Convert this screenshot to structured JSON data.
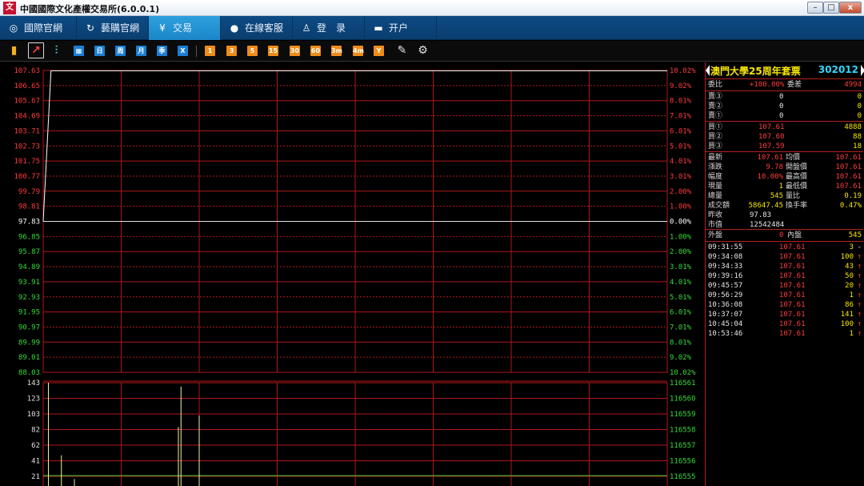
{
  "window": {
    "title": "中國國際文化產權交易所(6.0.0.1)",
    "icon_text": "文"
  },
  "nav": {
    "tabs": [
      {
        "label": "國際官網",
        "icon": "globe-icon"
      },
      {
        "label": "藝購官網",
        "icon": "link-icon"
      },
      {
        "label": "交易",
        "icon": "trade-icon"
      },
      {
        "label": "在線客服",
        "icon": "chat-icon"
      },
      {
        "label": "登　录",
        "icon": "user-icon"
      },
      {
        "label": "开户",
        "icon": "card-icon"
      }
    ]
  },
  "toolbar": {
    "period_buttons": [
      "日",
      "周",
      "月",
      "季",
      "X"
    ],
    "minute_buttons": [
      "1",
      "3",
      "5",
      "15",
      "30",
      "60",
      "3m",
      "4m",
      "Y"
    ]
  },
  "chart_data": {
    "type": "line",
    "price_axis_left": [
      "107.63",
      "106.65",
      "105.67",
      "104.69",
      "103.71",
      "102.73",
      "101.75",
      "100.77",
      "99.79",
      "98.81",
      "97.83",
      "96.85",
      "95.87",
      "94.89",
      "93.91",
      "92.93",
      "91.95",
      "90.97",
      "89.99",
      "89.01",
      "88.03"
    ],
    "price_axis_right": [
      "10.02%",
      "9.02%",
      "8.01%",
      "7.01%",
      "6.01%",
      "5.01%",
      "4.01%",
      "3.01%",
      "2.00%",
      "1.00%",
      "0.00%",
      "1.00%",
      "2.00%",
      "3.01%",
      "4.01%",
      "5.01%",
      "6.01%",
      "7.01%",
      "8.01%",
      "9.02%",
      "10.02%"
    ],
    "volume_axis_left": [
      "143",
      "123",
      "103",
      "82",
      "62",
      "41",
      "21"
    ],
    "volume_axis_right": [
      "116561",
      "116560",
      "116559",
      "116558",
      "116557",
      "116556",
      "116555"
    ],
    "prev_close": 97.83,
    "price_ylim": [
      88.03,
      107.63
    ],
    "price_series": {
      "x_minutes": [
        0,
        3,
        240
      ],
      "values": [
        97.83,
        107.61,
        107.61
      ]
    },
    "volume_ylim": [
      0,
      143
    ],
    "volume_bars": [
      {
        "minute": 2,
        "value": 143
      },
      {
        "minute": 7,
        "value": 48
      },
      {
        "minute": 12,
        "value": 17
      },
      {
        "minute": 52,
        "value": 85
      },
      {
        "minute": 53,
        "value": 138
      },
      {
        "minute": 60,
        "value": 100
      }
    ],
    "grid": true,
    "colors": {
      "grid": "#b01818",
      "price_line": "#ffffff",
      "volume_bar": "#f0f0a0",
      "baseline": "#33cc33",
      "up": "#ff3b3b",
      "down": "#33dd33",
      "flat": "#ffffff"
    }
  },
  "quote": {
    "name": "澳門大學25周年套票",
    "code": "302012",
    "webi": {
      "label": "委比",
      "value": "+100.00%",
      "label2": "委差",
      "value2": "4994"
    },
    "asks": [
      {
        "label": "賣③",
        "price": "0",
        "vol": "0"
      },
      {
        "label": "賣②",
        "price": "0",
        "vol": "0"
      },
      {
        "label": "賣①",
        "price": "0",
        "vol": "0"
      }
    ],
    "bids": [
      {
        "label": "買①",
        "price": "107.61",
        "vol": "4888"
      },
      {
        "label": "買②",
        "price": "107.60",
        "vol": "88"
      },
      {
        "label": "買③",
        "price": "107.59",
        "vol": "18"
      }
    ],
    "stats": [
      {
        "l1": "最新",
        "v1": "107.61",
        "l2": "均價",
        "v2": "107.61"
      },
      {
        "l1": "漲跌",
        "v1": "9.78",
        "l2": "開盤價",
        "v2": "107.61"
      },
      {
        "l1": "幅度",
        "v1": "10.00%",
        "l2": "最高價",
        "v2": "107.61"
      },
      {
        "l1": "現量",
        "v1": "1",
        "l2": "最低價",
        "v2": "107.61"
      },
      {
        "l1": "總量",
        "v1": "545",
        "l2": "量比",
        "v2": "0.19"
      },
      {
        "l1": "成交額",
        "v1": "58647.45",
        "l2": "換手率",
        "v2": "0.47%"
      },
      {
        "l1": "昨收",
        "v1": "97.83",
        "l2": "",
        "v2": ""
      },
      {
        "l1": "市值",
        "v1": "12542484",
        "l2": "",
        "v2": ""
      }
    ],
    "outer": {
      "label": "外盤",
      "value": "0",
      "label2": "內盤",
      "value2": "545"
    },
    "ticks": [
      {
        "time": "09:31:55",
        "price": "107.61",
        "vol": "3",
        "dir": "-"
      },
      {
        "time": "09:34:08",
        "price": "107.61",
        "vol": "100",
        "dir": "↑"
      },
      {
        "time": "09:34:33",
        "price": "107.61",
        "vol": "43",
        "dir": "↑"
      },
      {
        "time": "09:39:16",
        "price": "107.61",
        "vol": "50",
        "dir": "↑"
      },
      {
        "time": "09:45:57",
        "price": "107.61",
        "vol": "20",
        "dir": "↑"
      },
      {
        "time": "09:56:29",
        "price": "107.61",
        "vol": "1",
        "dir": "↑"
      },
      {
        "time": "10:36:08",
        "price": "107.61",
        "vol": "86",
        "dir": "↑"
      },
      {
        "time": "10:37:07",
        "price": "107.61",
        "vol": "141",
        "dir": "↑"
      },
      {
        "time": "10:45:04",
        "price": "107.61",
        "vol": "100",
        "dir": "↑"
      },
      {
        "time": "10:53:46",
        "price": "107.61",
        "vol": "1",
        "dir": "↑"
      }
    ]
  }
}
